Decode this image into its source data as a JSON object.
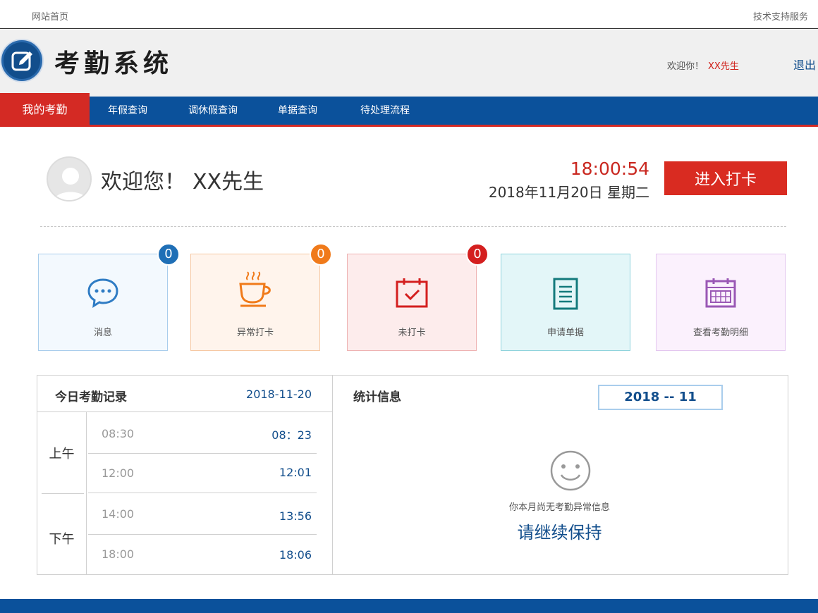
{
  "topbar": {
    "home": "网站首页",
    "support": "技术支持服务"
  },
  "header": {
    "title": "考勤系统",
    "welcome_prefix": "欢迎你！",
    "user": "XX先生",
    "logout": "退出"
  },
  "nav": {
    "items": [
      {
        "label": "我的考勤"
      },
      {
        "label": "年假查询"
      },
      {
        "label": "调休假查询"
      },
      {
        "label": "单据查询"
      },
      {
        "label": "待处理流程"
      }
    ]
  },
  "profile": {
    "greeting": "欢迎您！",
    "name": "XX先生",
    "time": "18:00:54",
    "date": "2018年11月20日  星期二",
    "punch_button": "进入打卡"
  },
  "cards": [
    {
      "label": "消息",
      "badge": "0",
      "icon": "chat-bubble-icon",
      "border": "#a9cdec",
      "bg": "#f3f9fe",
      "accent": "#2f7cc4",
      "badge_color": "#1f6fb6"
    },
    {
      "label": "异常打卡",
      "badge": "0",
      "icon": "coffee-cup-icon",
      "border": "#f6c8a3",
      "bg": "#fff4ec",
      "accent": "#f07a1a",
      "badge_color": "#f07a1a"
    },
    {
      "label": "未打卡",
      "badge": "0",
      "icon": "calendar-check-icon",
      "border": "#eeb2b2",
      "bg": "#fdecec",
      "accent": "#d41f1f",
      "badge_color": "#d41f1f"
    },
    {
      "label": "申请单据",
      "icon": "document-icon",
      "border": "#8fd3dc",
      "bg": "#e3f6f8",
      "accent": "#137a7c"
    },
    {
      "label": "查看考勤明细",
      "icon": "calendar-grid-icon",
      "border": "#e3c6ef",
      "bg": "#fbf1fd",
      "accent": "#9a58b5"
    }
  ],
  "today": {
    "title": "今日考勤记录",
    "date": "2018-11-20",
    "morning": "上午",
    "afternoon": "下午",
    "slots": [
      {
        "scheduled": "08:30",
        "actual": "08：23"
      },
      {
        "scheduled": "12:00",
        "actual": "12:01"
      },
      {
        "scheduled": "14:00",
        "actual": "13:56"
      },
      {
        "scheduled": "18:00",
        "actual": "18:06"
      }
    ]
  },
  "stats": {
    "title": "统计信息",
    "month": "2018 -- 11",
    "no_abnormal": "你本月尚无考勤异常信息",
    "keep_up": "请继续保持"
  }
}
